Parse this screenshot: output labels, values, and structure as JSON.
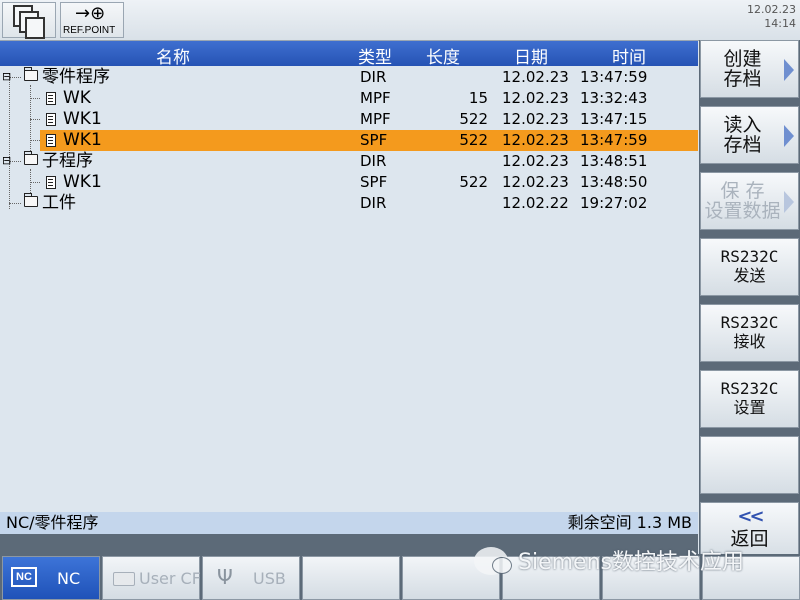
{
  "topbar": {
    "ref_label": "REF.POINT",
    "date": "12.02.23",
    "time": "14:14"
  },
  "table": {
    "headers": [
      "名称",
      "类型",
      "长度",
      "日期",
      "时间"
    ],
    "rows": [
      {
        "name": "零件程序",
        "type": "DIR",
        "length": "",
        "date": "12.02.23",
        "time": "13:47:59"
      },
      {
        "name": "WK",
        "type": "MPF",
        "length": "15",
        "date": "12.02.23",
        "time": "13:32:43"
      },
      {
        "name": "WK1",
        "type": "MPF",
        "length": "522",
        "date": "12.02.23",
        "time": "13:47:15"
      },
      {
        "name": "WK1",
        "type": "SPF",
        "length": "522",
        "date": "12.02.23",
        "time": "13:47:59"
      },
      {
        "name": "子程序",
        "type": "DIR",
        "length": "",
        "date": "12.02.23",
        "time": "13:48:51"
      },
      {
        "name": "WK1",
        "type": "SPF",
        "length": "522",
        "date": "12.02.23",
        "time": "13:48:50"
      },
      {
        "name": "工件",
        "type": "DIR",
        "length": "",
        "date": "12.02.22",
        "time": "19:27:02"
      }
    ]
  },
  "status": {
    "path": "NC/零件程序",
    "free_space": "剩余空间 1.3 MB"
  },
  "softkeys": {
    "create_archive": "创建\n存档",
    "read_archive": "读入\n存档",
    "save_setup": "保  存\n设置数据",
    "rs232_send": "RS232C\n发送",
    "rs232_receive": "RS232C\n接收",
    "rs232_settings": "RS232C\n设置",
    "back_chevron": "<<",
    "back": "返回"
  },
  "bottom_tabs": {
    "nc": "NC",
    "nc_icon": "NC",
    "usercf": "User CF",
    "usb": "USB"
  },
  "watermark": "Siemens数控技术应用",
  "colors": {
    "header_blue": "#2653b4",
    "selection_orange": "#f49a1d",
    "background": "#dde6ee"
  }
}
